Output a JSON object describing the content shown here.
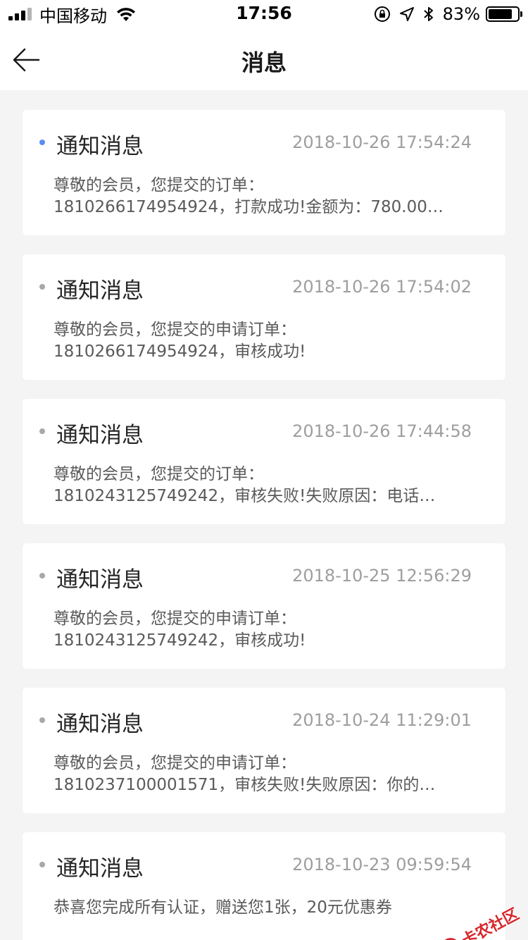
{
  "status_bar": {
    "carrier": "中国移动",
    "time": "17:56",
    "battery_percent_label": "83%",
    "battery_level": 0.83,
    "signal_bars_filled": 3,
    "signal_bars_total": 4,
    "icons": [
      "signal-icon",
      "wifi-icon",
      "orientation-lock-icon",
      "location-icon",
      "bluetooth-icon",
      "battery-icon"
    ]
  },
  "nav": {
    "title": "消息",
    "back_icon": "back-arrow-icon"
  },
  "colors": {
    "unread_dot": "#5b8ef5",
    "read_dot": "#a8a8a8",
    "background": "#f4f4f4",
    "card": "#ffffff"
  },
  "messages": [
    {
      "title": "通知消息",
      "time": "2018-10-26 17:54:24",
      "line1": "尊敬的会员，您提交的订单：",
      "line2": "1810266174954924，打款成功!金额为：780.00…",
      "unread": true
    },
    {
      "title": "通知消息",
      "time": "2018-10-26 17:54:02",
      "line1": "尊敬的会员，您提交的申请订单：",
      "line2": "1810266174954924，审核成功!",
      "unread": false
    },
    {
      "title": "通知消息",
      "time": "2018-10-26 17:44:58",
      "line1": "尊敬的会员，您提交的订单：",
      "line2": "1810243125749242，审核失败!失败原因：电话…",
      "unread": false
    },
    {
      "title": "通知消息",
      "time": "2018-10-25 12:56:29",
      "line1": "尊敬的会员，您提交的申请订单：",
      "line2": "1810243125749242，审核成功!",
      "unread": false
    },
    {
      "title": "通知消息",
      "time": "2018-10-24 11:29:01",
      "line1": "尊敬的会员，您提交的申请订单：",
      "line2": "1810237100001571，审核失败!失败原因：你的…",
      "unread": false
    },
    {
      "title": "通知消息",
      "time": "2018-10-23 09:59:54",
      "line1": "恭喜您完成所有认证，赠送您1张，20元优惠券",
      "line2": "",
      "unread": false
    }
  ],
  "watermark": {
    "text": "卡农社区"
  }
}
